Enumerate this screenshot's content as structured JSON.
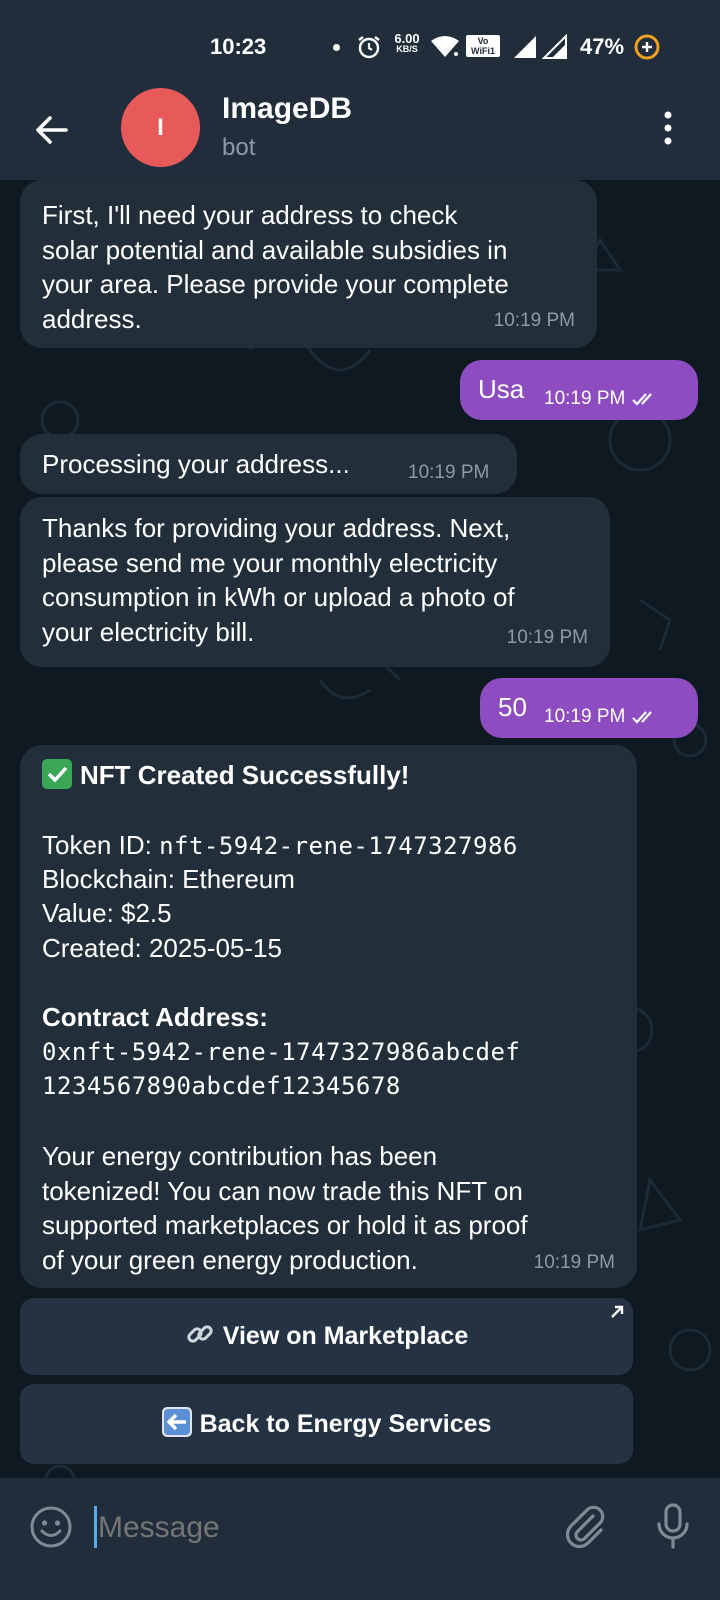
{
  "status_bar": {
    "time": "10:23",
    "speed_value": "6.00",
    "speed_unit": "KB/S",
    "volte_top": "Vo",
    "volte_bottom": "WiFi1",
    "battery": "47%"
  },
  "header": {
    "avatar_letter": "I",
    "title": "ImageDB",
    "subtitle": "bot"
  },
  "messages": [
    {
      "side": "in",
      "text": "First, I'll need your address to check\nsolar potential and available subsidies in\nyour area. Please provide your complete\naddress.",
      "time": "10:19 PM"
    },
    {
      "side": "out",
      "text": "Usa",
      "time": "10:19 PM"
    },
    {
      "side": "in",
      "text": "Processing your address...",
      "time": "10:19 PM"
    },
    {
      "side": "in",
      "text": "Thanks for providing your address. Next,\nplease send me your monthly electricity\nconsumption in kWh or upload a photo of\nyour electricity bill.",
      "time": "10:19 PM"
    },
    {
      "side": "out",
      "text": "50",
      "time": "10:19 PM"
    }
  ],
  "nft_message": {
    "title": "NFT Created Successfully!",
    "token_label": "Token ID: ",
    "token_value": "nft-5942-rene-1747327986",
    "blockchain": "Blockchain: Ethereum",
    "value": "Value: $2.5",
    "created": "Created: 2025-05-15",
    "contract_label": "Contract Address:",
    "contract_line1": "0xnft-5942-rene-1747327986abcdef",
    "contract_line2": "1234567890abcdef12345678",
    "footer": "Your energy contribution has been\ntokenized! You can now trade this NFT on\nsupported marketplaces or hold it as proof\nof your green energy production.",
    "time": "10:19 PM"
  },
  "inline_buttons": {
    "marketplace": "View on Marketplace",
    "back": "Back to Energy Services"
  },
  "input": {
    "placeholder": "Message"
  },
  "icons": {
    "back": "arrow-left-icon",
    "menu": "more-vertical-icon",
    "check": "check-mark-emoji",
    "link": "link-emoji",
    "back_arrow": "left-arrow-emoji",
    "emoji": "smiley-icon",
    "attach": "paperclip-icon",
    "mic": "microphone-icon"
  },
  "colors": {
    "header_bg": "#212d3b",
    "incoming_bubble": "#222e3a",
    "outgoing_bubble": "#8d4cc0",
    "avatar": "#e85a5a",
    "check_emoji": "#3aa757"
  }
}
